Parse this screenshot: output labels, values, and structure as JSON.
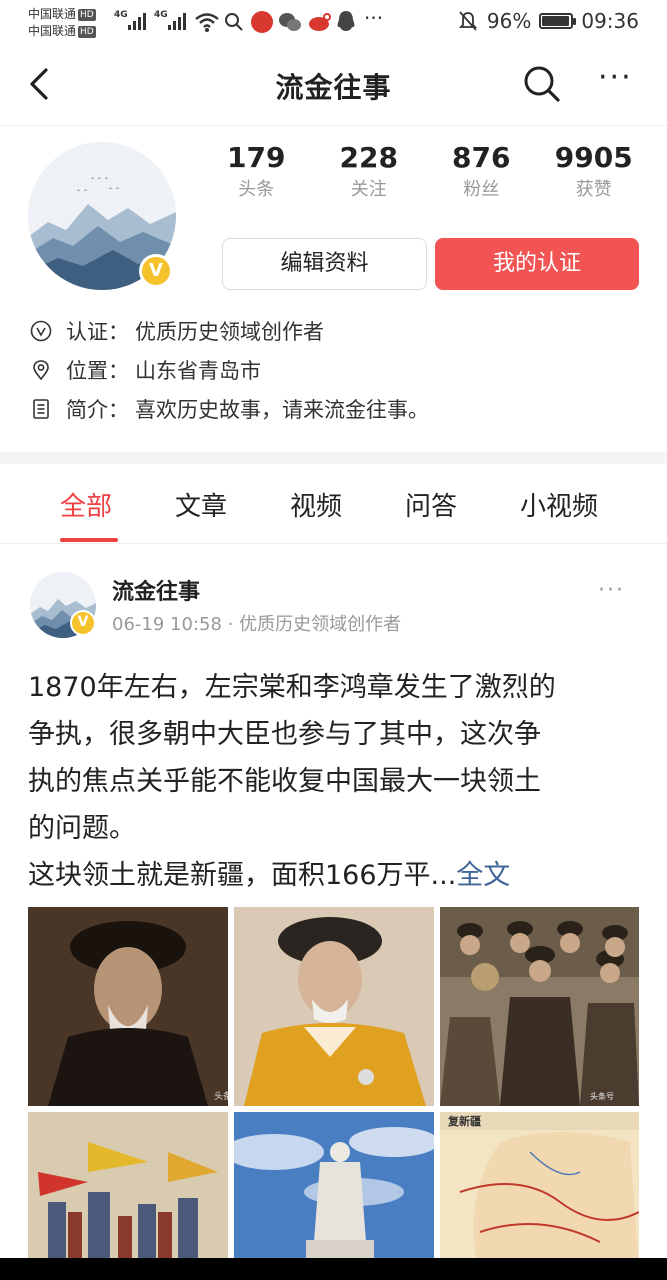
{
  "status_bar": {
    "carrier_1": "中国联通",
    "carrier_2": "中国联通",
    "hd": "HD",
    "network_1": "4G",
    "network_2": "4G",
    "battery_percent": "96%",
    "battery_level": 0.96,
    "time": "09:36",
    "icons": [
      "wifi-icon",
      "search-icon",
      "weibo-app-icon",
      "wechat-icon",
      "sina-icon",
      "qq-icon",
      "more-dots-icon",
      "mute-bell-icon",
      "battery-icon"
    ]
  },
  "header": {
    "title": "流金往事",
    "back_icon": "back-arrow-icon",
    "search_icon": "search-icon",
    "more_icon": "more-icon",
    "more_glyph": "···"
  },
  "profile": {
    "badge": "V",
    "stats": [
      {
        "num": "179",
        "label": "头条"
      },
      {
        "num": "228",
        "label": "关注"
      },
      {
        "num": "876",
        "label": "粉丝"
      },
      {
        "num": "9905",
        "label": "获赞"
      }
    ],
    "edit_button": "编辑资料",
    "cert_button": "我的认证",
    "info": [
      {
        "icon": "verified-icon",
        "key": "认证：",
        "value": "优质历史领域创作者"
      },
      {
        "icon": "location-icon",
        "key": "位置：",
        "value": "山东省青岛市"
      },
      {
        "icon": "document-icon",
        "key": "简介：",
        "value": "喜欢历史故事，请来流金往事。"
      }
    ]
  },
  "tabs": [
    {
      "label": "全部",
      "active": true
    },
    {
      "label": "文章",
      "active": false
    },
    {
      "label": "视频",
      "active": false
    },
    {
      "label": "问答",
      "active": false
    },
    {
      "label": "小视频",
      "active": false
    }
  ],
  "post": {
    "author": "流金往事",
    "meta": "06-19 10:58 · 优质历史领域创作者",
    "more_glyph": "···",
    "lines": [
      "1870年左右，左宗棠和李鸿章发生了激烈的",
      "争执，很多朝中大臣也参与了其中，这次争",
      "执的焦点关乎能不能收复中国最大一块领土",
      "的问题。",
      "这块领土就是新疆，面积166万平..."
    ],
    "full_link": "全文",
    "watermark": "头条号",
    "map_label": "复新疆",
    "photos": [
      "portrait-photo",
      "official-portrait-photo",
      "group-photo",
      "battle-painting-photo",
      "statue-photo",
      "map-photo"
    ]
  },
  "colors": {
    "accent": "#f04142",
    "cert_button": "#f25454",
    "link": "#406599",
    "badge": "#f6c22c"
  }
}
